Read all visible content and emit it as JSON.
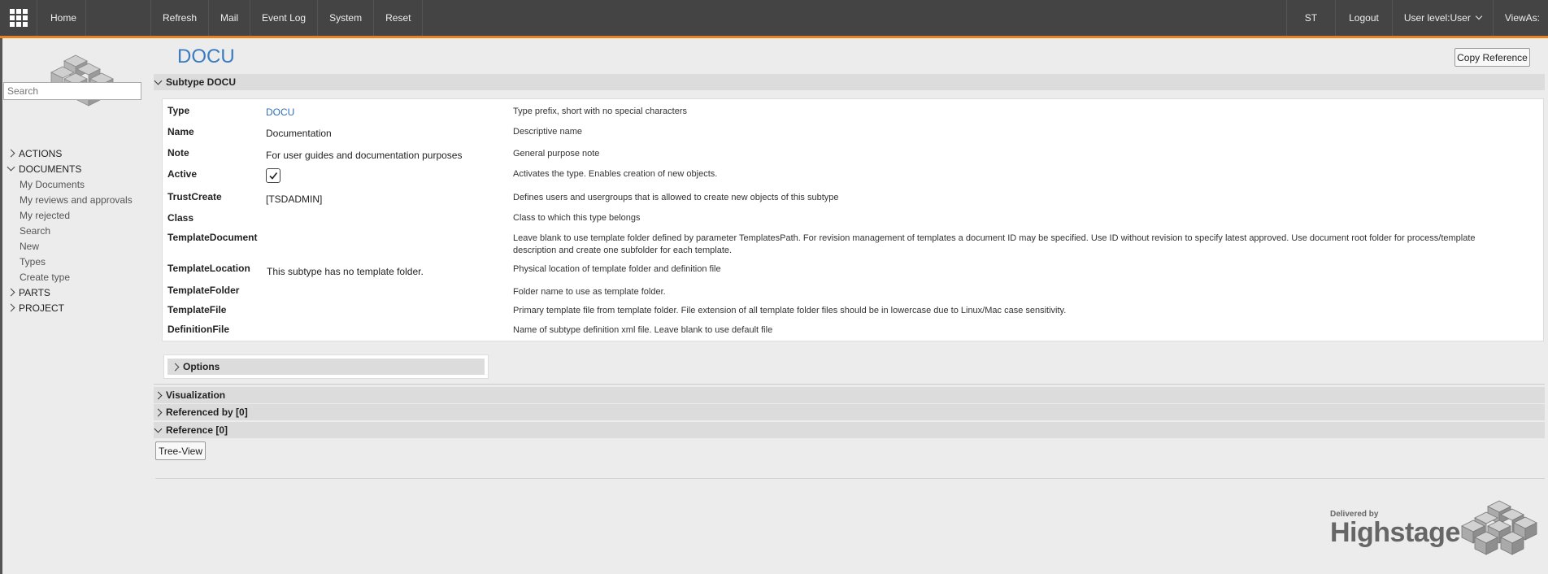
{
  "topbar": {
    "left_items": [
      "Home"
    ],
    "center_items": [
      "Refresh",
      "Mail",
      "Event Log",
      "System",
      "Reset"
    ],
    "right_items": {
      "user": "ST",
      "logout": "Logout",
      "user_level": "User level:User",
      "view_as": "ViewAs:"
    }
  },
  "sidebar": {
    "search_placeholder": "Search",
    "tree": [
      {
        "label": "ACTIONS",
        "expanded": false
      },
      {
        "label": "DOCUMENTS",
        "expanded": true,
        "children": [
          "My Documents",
          "My reviews and approvals",
          "My rejected",
          "Search",
          "New",
          "Types",
          "Create type"
        ]
      },
      {
        "label": "PARTS",
        "expanded": false
      },
      {
        "label": "PROJECT",
        "expanded": false
      }
    ]
  },
  "main": {
    "title": "DOCU",
    "copy_reference": "Copy Reference",
    "section_subtype": "Subtype DOCU",
    "properties": [
      {
        "name": "Type",
        "value": "DOCU",
        "desc": "Type prefix, short with no special characters"
      },
      {
        "name": "Name",
        "value": "Documentation",
        "desc": "Descriptive name"
      },
      {
        "name": "Note",
        "value": "For user guides and documentation purposes",
        "desc": "General purpose note"
      },
      {
        "name": "Active",
        "value": "",
        "checked": true,
        "desc": "Activates the type. Enables creation of new objects."
      },
      {
        "name": "TrustCreate",
        "value": "[TSDADMIN]",
        "desc": "Defines users and usergroups that is allowed to create new objects of this subtype"
      },
      {
        "name": "Class",
        "value": "",
        "desc": "Class to which this type belongs"
      },
      {
        "name": "TemplateDocument",
        "value": "",
        "desc": "Leave blank to use template folder defined by parameter TemplatesPath. For revision management of templates a document ID may be specified. Use ID without revision to specify latest approved. Use document root folder for process/template description and create one subfolder for each template."
      },
      {
        "name": "TemplateLocation",
        "value": "This subtype has no template folder.",
        "desc": "Physical location of template folder and definition file"
      },
      {
        "name": "TemplateFolder",
        "value": "",
        "desc": "Folder name to use as template folder."
      },
      {
        "name": "TemplateFile",
        "value": "",
        "desc": "Primary template file from template folder. File extension of all template folder files should be in lowercase due to Linux/Mac case sensitivity."
      },
      {
        "name": "DefinitionFile",
        "value": "",
        "desc": "Name of subtype definition xml file. Leave blank to use default file"
      }
    ],
    "options": "Options",
    "visualization": "Visualization",
    "referenced_by": "Referenced by [0]",
    "reference": "Reference [0]",
    "tree_view": "Tree-View"
  },
  "footer": {
    "delivered_by": "Delivered by",
    "brand": "Highstage"
  },
  "colors": {
    "topbar": "#444444",
    "accent_line": "#e8821c",
    "title": "#3a7cc0",
    "link": "#2f6eb5"
  }
}
